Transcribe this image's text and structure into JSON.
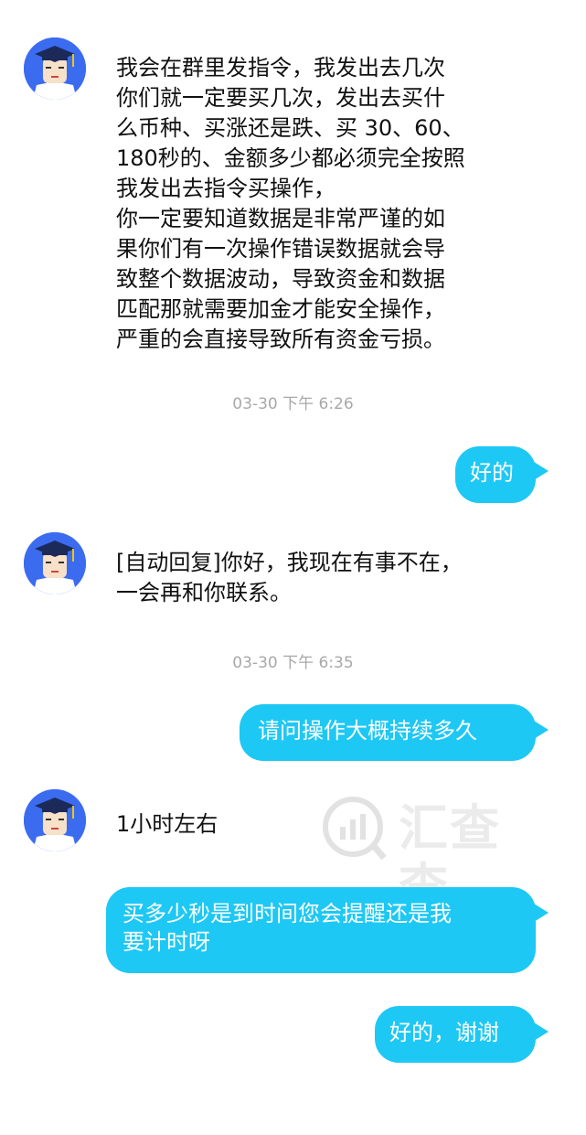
{
  "messages": {
    "m1": {
      "text": "我会在群里发指令，我发出去几次\n你们就一定要买几次，发出去买什\n么币种、买涨还是跌、买 30、60、\n180秒的、金额多少都必须完全按照\n我发出去指令买操作，\n你一定要知道数据是非常严谨的如\n果你们有一次操作错误数据就会导\n致整个数据波动，导致资金和数据\n匹配那就需要加金才能安全操作，\n严重的会直接导致所有资金亏损。"
    },
    "ts1": "03-30 下午 6:26",
    "m2": {
      "text": "好的"
    },
    "m3": {
      "text": "[自动回复]你好，我现在有事不在，\n一会再和你联系。"
    },
    "ts2": "03-30 下午 6:35",
    "m4": {
      "text": "请问操作大概持续多久"
    },
    "m5": {
      "text": "1小时左右"
    },
    "m6": {
      "text": "买多少秒是到时间您会提醒还是我\n要计时呀"
    },
    "m7": {
      "text": "好的，谢谢"
    }
  },
  "watermark": {
    "text": "汇查查",
    "icon": "bar-chart-circle-icon"
  },
  "colors": {
    "bubble": "#1ec8f4",
    "avatar_bg": "#3b6cf0",
    "timestamp": "#a8a8a8"
  }
}
